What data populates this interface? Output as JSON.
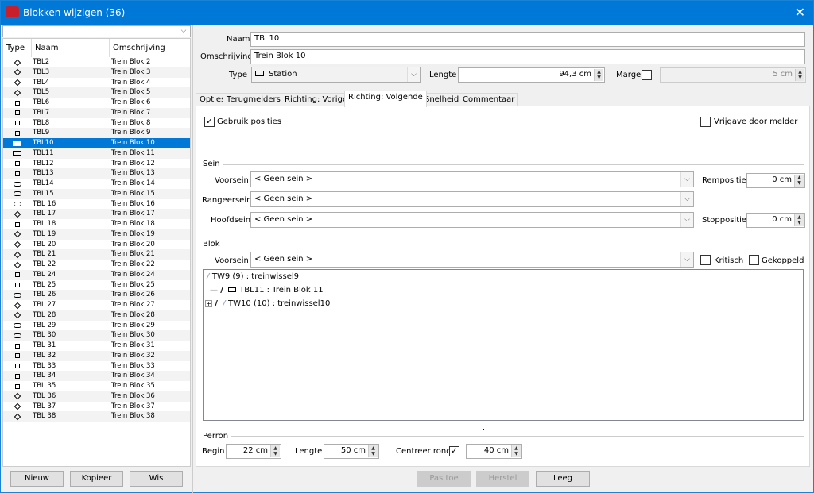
{
  "window": {
    "title": "Blokken wijzigen (36)",
    "close_icon": "close-icon",
    "accent": "#0078d7"
  },
  "list": {
    "filter_value": "",
    "columns": [
      "Type",
      "Naam",
      "Omschrijving"
    ],
    "selected": "TBL10",
    "rows": [
      {
        "type": "diamond",
        "name": "TBL2",
        "desc": "Trein Blok 2"
      },
      {
        "type": "diamond",
        "name": "TBL3",
        "desc": "Trein Blok 3"
      },
      {
        "type": "diamond",
        "name": "TBL4",
        "desc": "Trein Blok 4"
      },
      {
        "type": "diamond",
        "name": "TBL5",
        "desc": "Trein Blok 5"
      },
      {
        "type": "square",
        "name": "TBL6",
        "desc": "Trein Blok 6"
      },
      {
        "type": "square",
        "name": "TBL7",
        "desc": "Trein Blok 7"
      },
      {
        "type": "square",
        "name": "TBL8",
        "desc": "Trein Blok 8"
      },
      {
        "type": "square",
        "name": "TBL9",
        "desc": "Trein Blok 9"
      },
      {
        "type": "station",
        "name": "TBL10",
        "desc": "Trein Blok 10"
      },
      {
        "type": "station",
        "name": "TBL11",
        "desc": "Trein Blok 11"
      },
      {
        "type": "square",
        "name": "TBL12",
        "desc": "Trein Blok 12"
      },
      {
        "type": "square",
        "name": "TBL13",
        "desc": "Trein Blok 13"
      },
      {
        "type": "oval",
        "name": "TBL14",
        "desc": "Trein Blok 14"
      },
      {
        "type": "oval",
        "name": "TBL15",
        "desc": "Trein Blok 15"
      },
      {
        "type": "oval",
        "name": "TBL 16",
        "desc": "Trein Blok 16"
      },
      {
        "type": "diamond",
        "name": "TBL 17",
        "desc": "Trein Blok 17"
      },
      {
        "type": "square",
        "name": "TBL 18",
        "desc": "Trein Blok 18"
      },
      {
        "type": "diamond",
        "name": "TBL 19",
        "desc": "Trein Blok 19"
      },
      {
        "type": "diamond",
        "name": "TBL 20",
        "desc": "Trein Blok 20"
      },
      {
        "type": "diamond",
        "name": "TBL 21",
        "desc": "Trein Blok 21"
      },
      {
        "type": "diamond",
        "name": "TBL 22",
        "desc": "Trein Blok 22"
      },
      {
        "type": "square",
        "name": "TBL 24",
        "desc": "Trein Blok 24"
      },
      {
        "type": "square",
        "name": "TBL 25",
        "desc": "Trein Blok 25"
      },
      {
        "type": "oval",
        "name": "TBL 26",
        "desc": "Trein Blok 26"
      },
      {
        "type": "diamond",
        "name": "TBL 27",
        "desc": "Trein Blok 27"
      },
      {
        "type": "diamond",
        "name": "TBL 28",
        "desc": "Trein Blok 28"
      },
      {
        "type": "oval",
        "name": "TBL 29",
        "desc": "Trein Blok 29"
      },
      {
        "type": "oval",
        "name": "TBL 30",
        "desc": "Trein Blok 30"
      },
      {
        "type": "square",
        "name": "TBL 31",
        "desc": "Trein Blok 31"
      },
      {
        "type": "square",
        "name": "TBL 32",
        "desc": "Trein Blok 32"
      },
      {
        "type": "square",
        "name": "TBL 33",
        "desc": "Trein Blok 33"
      },
      {
        "type": "square",
        "name": "TBL 34",
        "desc": "Trein Blok 34"
      },
      {
        "type": "square",
        "name": "TBL 35",
        "desc": "Trein Blok 35"
      },
      {
        "type": "diamond",
        "name": "TBL 36",
        "desc": "Trein Blok 36"
      },
      {
        "type": "diamond",
        "name": "TBL 37",
        "desc": "Trein Blok 37"
      },
      {
        "type": "diamond",
        "name": "TBL 38",
        "desc": "Trein Blok 38"
      }
    ],
    "buttons": {
      "new": "Nieuw",
      "copy": "Kopieer",
      "delete": "Wis"
    }
  },
  "form": {
    "naam_label": "Naam",
    "naam": "TBL10",
    "omschrijving_label": "Omschrijving",
    "omschrijving": "Trein Blok 10",
    "type_label": "Type",
    "type": "Station",
    "lengte_label": "Lengte",
    "lengte": "94,3 cm",
    "marge_label": "Marge",
    "marge_checked": false,
    "marge": "5 cm"
  },
  "tabs": [
    "Opties",
    "Terugmelders",
    "Richting: Vorige",
    "Richting: Volgende",
    "Snelheid",
    "Commentaar"
  ],
  "active_tab": "Richting: Volgende",
  "panel": {
    "gebruik_posities": "Gebruik posities",
    "gebruik_checked": true,
    "vrijgave": "Vrijgave door melder",
    "vrijgave_checked": false,
    "sein": {
      "title": "Sein",
      "voorsein_label": "Voorsein",
      "voorsein": "< Geen sein >",
      "rangeersein_label": "Rangeersein",
      "rangeersein": "< Geen sein >",
      "hoofdsein_label": "Hoofdsein",
      "hoofdsein": "< Geen sein >",
      "rempositie_label": "Rempositie",
      "rempositie": "0 cm",
      "stoppositie_label": "Stoppositie",
      "stoppositie": "0 cm"
    },
    "blok": {
      "title": "Blok",
      "voorsein_label": "Voorsein",
      "voorsein": "< Geen sein >",
      "kritisch": "Kritisch",
      "kritisch_checked": false,
      "gekoppeld": "Gekoppeld",
      "gekoppeld_checked": false
    },
    "tree": [
      "TW9 (9) : treinwissel9",
      "TBL11 : Trein Blok 11",
      "TW10 (10) : treinwissel10"
    ],
    "perron": {
      "title": "Perron",
      "begin_label": "Begin",
      "begin": "22 cm",
      "lengte_label": "Lengte",
      "lengte": "50 cm",
      "centreer_label": "Centreer rond",
      "centreer_checked": true,
      "centreer": "40 cm"
    }
  },
  "footer": {
    "apply": "Pas toe",
    "reset": "Herstel",
    "clear": "Leeg"
  }
}
